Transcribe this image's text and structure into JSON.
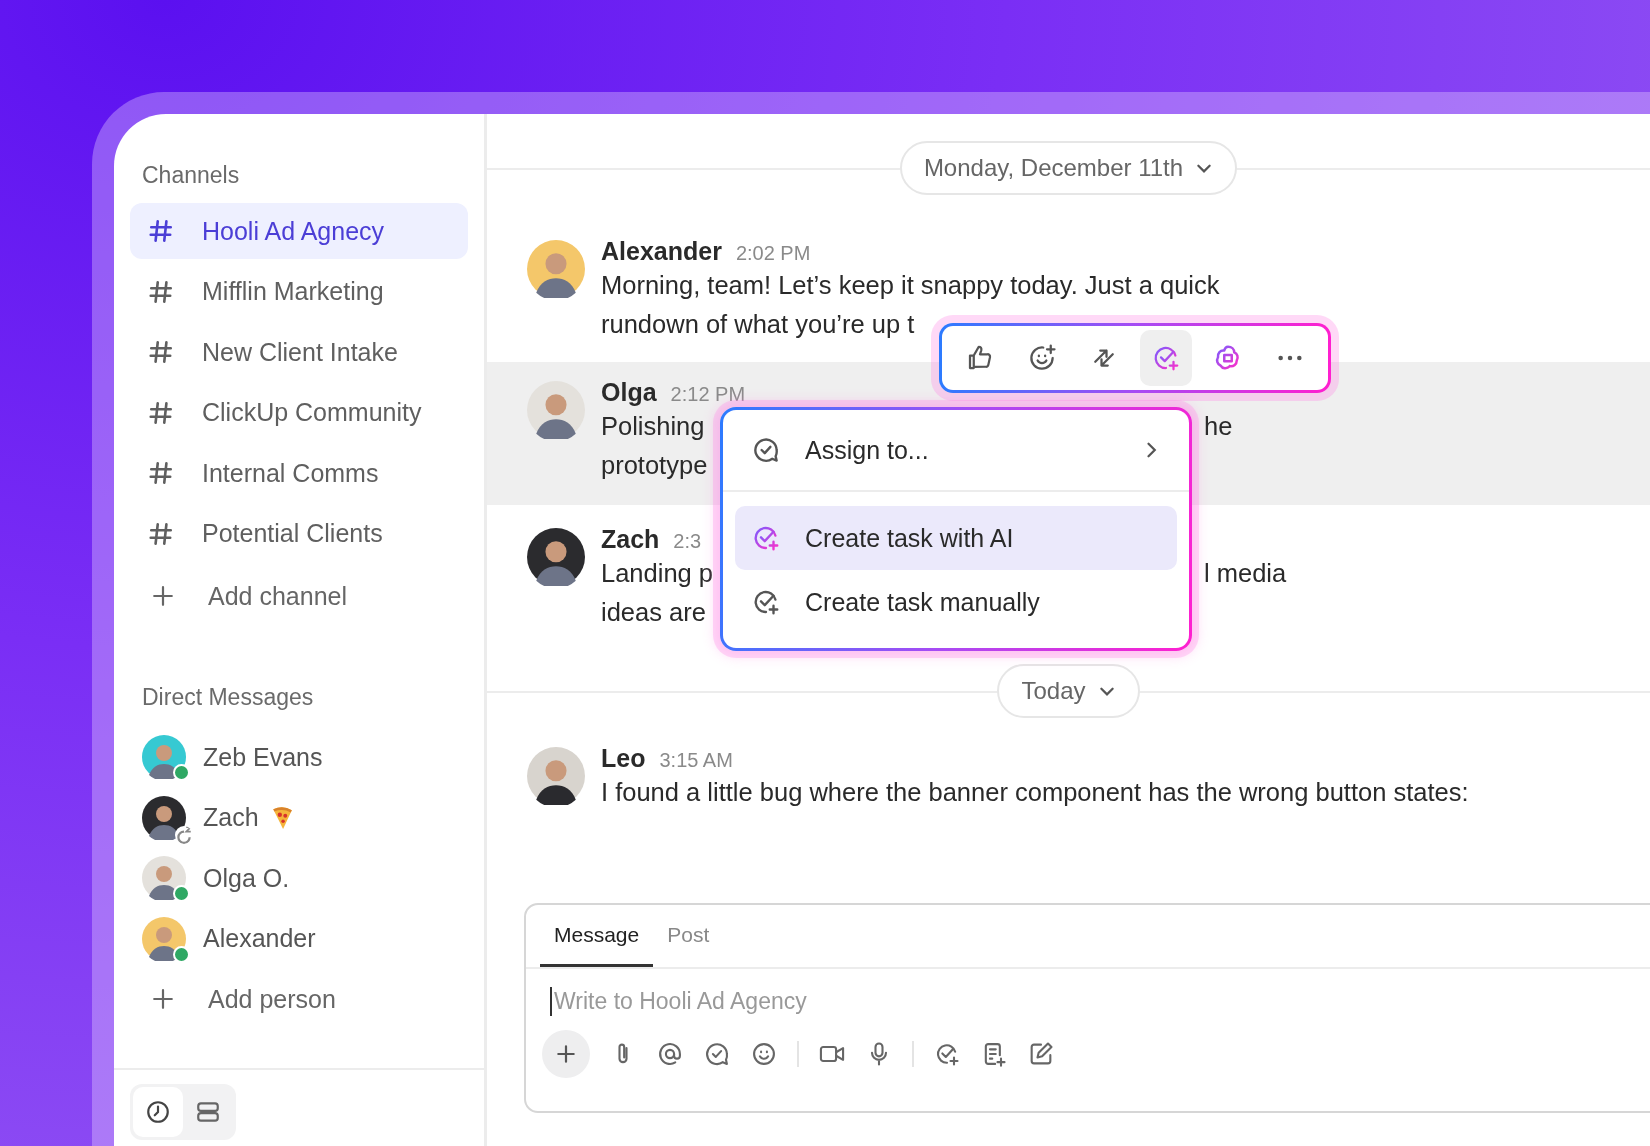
{
  "sidebar": {
    "channels_heading": "Channels",
    "channels": [
      {
        "name": "Hooli Ad Agnecy",
        "selected": true
      },
      {
        "name": "Mifflin Marketing",
        "selected": false
      },
      {
        "name": "New Client Intake",
        "selected": false
      },
      {
        "name": "ClickUp Community",
        "selected": false
      },
      {
        "name": "Internal Comms",
        "selected": false
      },
      {
        "name": "Potential Clients",
        "selected": false
      }
    ],
    "add_channel": "Add channel",
    "dm_heading": "Direct Messages",
    "people": [
      {
        "name": "Zeb Evans",
        "online": true,
        "status_emoji": false,
        "color": "#36c9d2"
      },
      {
        "name": "Zach",
        "online": false,
        "status_emoji": true,
        "color": "#2b2b2e"
      },
      {
        "name": "Olga O.",
        "online": true,
        "status_emoji": false,
        "color": "#e4e1dc"
      },
      {
        "name": "Alexander",
        "online": true,
        "status_emoji": false,
        "color": "#f4c76a"
      }
    ],
    "add_person": "Add person",
    "view_toggle": [
      {
        "kind": "clock",
        "selected": true
      },
      {
        "kind": "list",
        "selected": false
      }
    ]
  },
  "chat": {
    "date_divider": "Monday, December 11th",
    "messages": [
      {
        "author": "Alexander",
        "time": "2:02 PM",
        "highlighted": false,
        "color": "#f4c76a",
        "lines": [
          {
            "left": "Morning, team! Let’s keep it snappy today. Just a quick"
          },
          {
            "left": "rundown of what you’re up t"
          }
        ]
      },
      {
        "author": "Olga",
        "time": "2:12 PM",
        "highlighted": true,
        "color": "#e4e1dc",
        "lines": [
          {
            "left": "Polishing",
            "right": "he"
          },
          {
            "left": "prototype"
          }
        ]
      },
      {
        "author": "Zach",
        "time": "2:3",
        "highlighted": false,
        "color": "#2b2b2e",
        "lines": [
          {
            "left": "Landing p",
            "right": "l media"
          },
          {
            "left": "ideas are"
          }
        ]
      }
    ],
    "today_divider": "Today",
    "later_messages": [
      {
        "author": "Leo",
        "time": "3:15 AM",
        "highlighted": false,
        "color": "#d8d4ce",
        "lines": [
          {
            "left": "I found a little bug where the banner component has the wrong button states:"
          }
        ]
      }
    ]
  },
  "action_bar": [
    {
      "kind": "like",
      "selected": false
    },
    {
      "kind": "react",
      "selected": false
    },
    {
      "kind": "thread",
      "selected": false
    },
    {
      "kind": "task",
      "selected": true
    },
    {
      "kind": "ai",
      "selected": false
    },
    {
      "kind": "more",
      "selected": false
    }
  ],
  "task_menu": [
    {
      "kind": "assign",
      "label": "Assign to...",
      "submenu": true,
      "selected": false
    },
    {
      "kind": "ai_task",
      "label": "Create task with AI",
      "submenu": false,
      "selected": true
    },
    {
      "kind": "manual_task",
      "label": "Create task manually",
      "submenu": false,
      "selected": false
    }
  ],
  "composer": {
    "tabs": [
      {
        "label": "Message",
        "selected": true
      },
      {
        "label": "Post",
        "selected": false
      }
    ],
    "placeholder": "Write to Hooli Ad Agency",
    "tools": [
      {
        "kind": "plus"
      },
      {
        "kind": "attach"
      },
      {
        "kind": "mention"
      },
      {
        "kind": "comment"
      },
      {
        "kind": "emoji"
      },
      {
        "kind": "divider"
      },
      {
        "kind": "video"
      },
      {
        "kind": "mic"
      },
      {
        "kind": "divider"
      },
      {
        "kind": "task"
      },
      {
        "kind": "doc"
      },
      {
        "kind": "whiteboard"
      }
    ]
  }
}
